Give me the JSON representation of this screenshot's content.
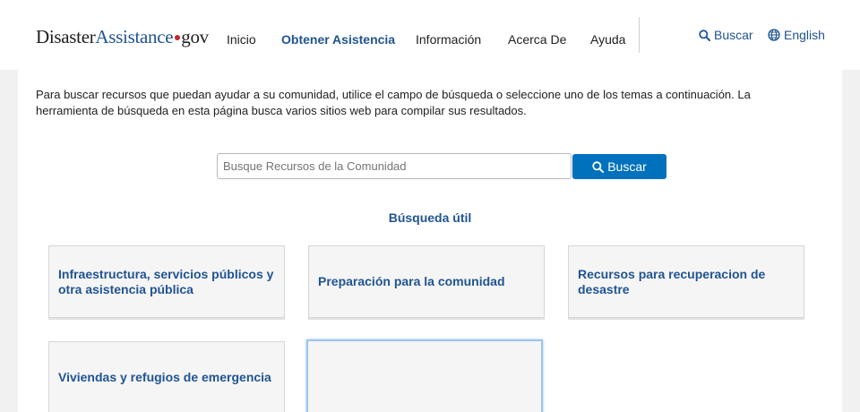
{
  "header": {
    "logo": {
      "part1": "Disaster",
      "part2": "Assistance",
      "part3": "gov"
    },
    "nav": [
      "Inicio",
      "Obtener Asistencia",
      "Información",
      "Acerca De",
      "Ayuda"
    ],
    "search_label": "Buscar",
    "language_label": "English"
  },
  "main": {
    "intro": "Para buscar recursos que puedan ayudar a su comunidad, utilice el campo de búsqueda o seleccione uno de los temas a continuación. La herramienta de búsqueda en esta página busca varios sitios web para compilar sus resultados.",
    "search": {
      "placeholder": "Busque Recursos de la Comunidad",
      "value": "",
      "button_label": "Buscar"
    },
    "section_title": "Búsqueda útil",
    "cards": [
      "Infraestructura, servicios públicos y otra asistencia pública",
      "Preparación para la comunidad",
      "Recursos para recuperacion de desastre",
      "Viviendas y refugios de emergencia",
      ""
    ]
  },
  "colors": {
    "primary": "#205493",
    "button": "#0071bc",
    "focus": "#9cc5ec",
    "logo_dot": "#c62828"
  }
}
